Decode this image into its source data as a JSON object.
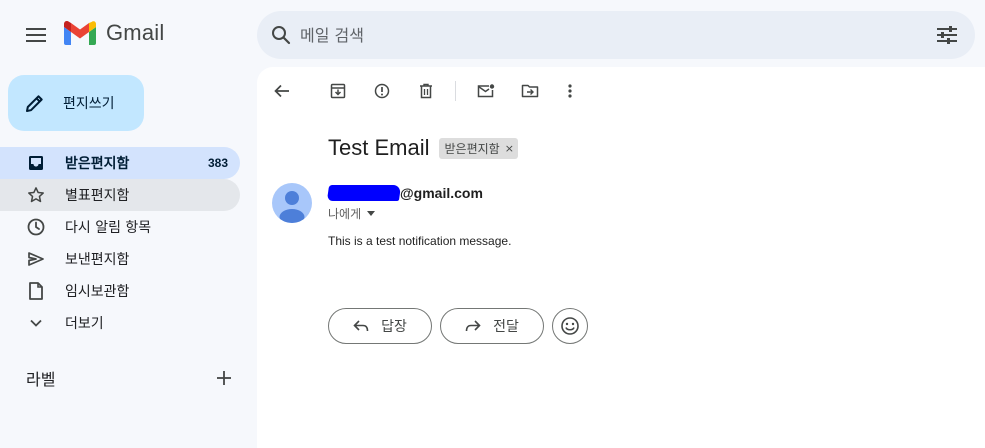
{
  "app": {
    "name": "Gmail"
  },
  "header": {
    "search_placeholder": "메일 검색"
  },
  "sidebar": {
    "compose_label": "편지쓰기",
    "items": [
      {
        "label": "받은편지함",
        "count": "383",
        "icon": "inbox-icon",
        "active": true
      },
      {
        "label": "별표편지함",
        "icon": "star-icon"
      },
      {
        "label": "다시 알림 항목",
        "icon": "clock-icon"
      },
      {
        "label": "보낸편지함",
        "icon": "send-icon"
      },
      {
        "label": "임시보관함",
        "icon": "draft-icon"
      },
      {
        "label": "더보기",
        "icon": "chevron-down-icon"
      }
    ],
    "labels_heading": "라벨"
  },
  "email": {
    "subject": "Test Email",
    "label_chip": "받은편지함",
    "label_chip_close": "×",
    "sender_suffix": "@gmail.com",
    "recipient": "나에게",
    "body": "This is a test notification message."
  },
  "actions": {
    "reply_label": "답장",
    "forward_label": "전달"
  },
  "colors": {
    "background": "#f6f8fc",
    "compose": "#c2e7ff",
    "active_nav": "#d3e3fd",
    "search": "#e9eef6",
    "avatar": "#a8c7fa",
    "redaction": "#0000ff"
  }
}
